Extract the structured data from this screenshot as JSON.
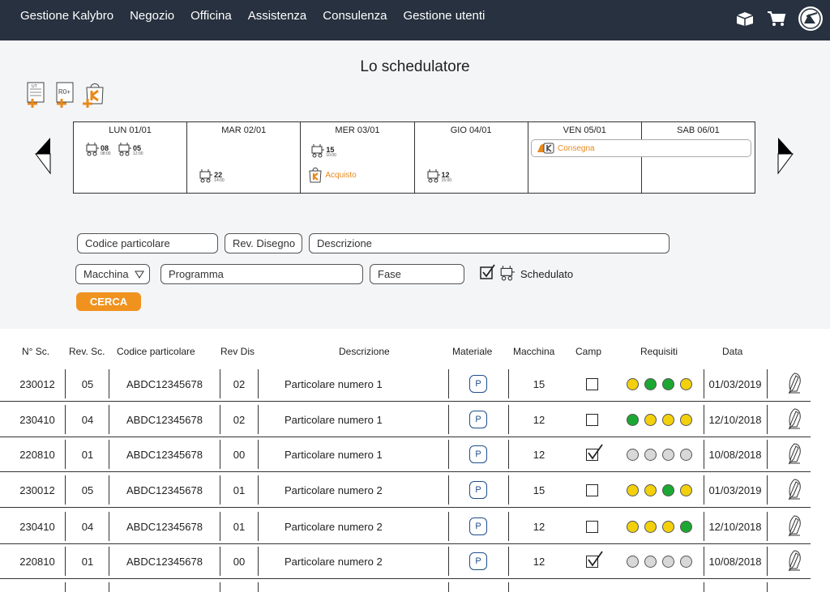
{
  "nav": {
    "items": [
      "Gestione Kalybro",
      "Negozio",
      "Officina",
      "Assistenza",
      "Consulenza",
      "Gestione utenti"
    ],
    "icons": [
      "package-icon",
      "cart-icon",
      "avatar-icon"
    ]
  },
  "page": {
    "title": "Lo schedulatore",
    "tool_labels": [
      "UT",
      "R0+",
      ""
    ]
  },
  "calendar": {
    "days": [
      {
        "label": "LUN 01/01"
      },
      {
        "label": "MAR 02/01"
      },
      {
        "label": "MER 03/01"
      },
      {
        "label": "GIO 04/01"
      },
      {
        "label": "VEN 05/01"
      },
      {
        "label": "SAB 06/01"
      }
    ],
    "events": [
      {
        "num": "08",
        "sub": "08:00"
      },
      {
        "num": "05",
        "sub": "12:00"
      },
      {
        "num": "22",
        "sub": "14:00"
      },
      {
        "num": "15",
        "sub": "10:00"
      },
      {
        "num": "12",
        "sub": "15:00"
      }
    ],
    "purchase_label": "Acquisto",
    "delivery_label": "Consegna"
  },
  "filters": {
    "codice": "Codice particolare",
    "rev": "Rev. Disegno",
    "descrizione": "Descrizione",
    "macchina": "Macchina",
    "programma": "Programma",
    "fase": "Fase",
    "schedulato": "Schedulato",
    "cerca": "CERCA"
  },
  "table": {
    "headers": [
      "N° Sc.",
      "Rev. Sc.",
      "Codice particolare",
      "Rev Dis",
      "Descrizione",
      "Materiale",
      "Macchina",
      "Camp",
      "Requisiti",
      "Data"
    ],
    "material_label": "P",
    "colors": {
      "yellow": "#f2d00c",
      "green": "#1ba832",
      "grey": "#d8d8d8"
    },
    "rows": [
      {
        "nsc": "230012",
        "rev": "05",
        "code": "ABDC12345678",
        "revdis": "02",
        "desc": "Particolare numero 1",
        "mac": "15",
        "camp": false,
        "req": [
          "yellow",
          "green",
          "green",
          "yellow"
        ],
        "date": "01/03/2019"
      },
      {
        "nsc": "230410",
        "rev": "04",
        "code": "ABDC12345678",
        "revdis": "02",
        "desc": "Particolare numero 1",
        "mac": "12",
        "camp": false,
        "req": [
          "green",
          "yellow",
          "yellow",
          "yellow"
        ],
        "date": "12/10/2018"
      },
      {
        "nsc": "220810",
        "rev": "01",
        "code": "ABDC12345678",
        "revdis": "00",
        "desc": "Particolare numero 1",
        "mac": "12",
        "camp": true,
        "req": [
          "grey",
          "grey",
          "grey",
          "grey"
        ],
        "date": "10/08/2018"
      },
      {
        "nsc": "230012",
        "rev": "05",
        "code": "ABDC12345678",
        "revdis": "01",
        "desc": "Particolare numero 2",
        "mac": "15",
        "camp": false,
        "req": [
          "yellow",
          "yellow",
          "green",
          "yellow"
        ],
        "date": "01/03/2019"
      },
      {
        "nsc": "230410",
        "rev": "04",
        "code": "ABDC12345678",
        "revdis": "01",
        "desc": "Particolare numero 2",
        "mac": "12",
        "camp": false,
        "req": [
          "yellow",
          "yellow",
          "yellow",
          "green"
        ],
        "date": "12/10/2018"
      },
      {
        "nsc": "220810",
        "rev": "01",
        "code": "ABDC12345678",
        "revdis": "00",
        "desc": "Particolare numero 2",
        "mac": "12",
        "camp": true,
        "req": [
          "grey",
          "grey",
          "grey",
          "grey"
        ],
        "date": "10/08/2018"
      }
    ]
  }
}
